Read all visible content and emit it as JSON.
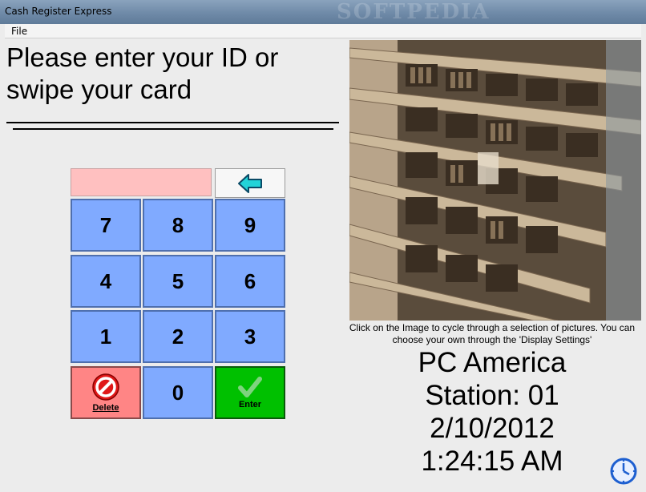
{
  "window": {
    "title": "Cash Register Express",
    "watermark": "SOFTPEDIA"
  },
  "menu": {
    "file": "File"
  },
  "login": {
    "prompt": "Please enter your ID or swipe your card",
    "input_value": ""
  },
  "keypad": {
    "keys": [
      "7",
      "8",
      "9",
      "4",
      "5",
      "6",
      "1",
      "2",
      "3"
    ],
    "zero": "0",
    "delete_label": "Delete",
    "enter_label": "Enter"
  },
  "display": {
    "caption": "Click on the Image to cycle through a selection of pictures. You can choose your own through the 'Display Settings'",
    "company": "PC America",
    "station": "Station: 01",
    "date": "2/10/2012",
    "time": "1:24:15 AM"
  },
  "colors": {
    "key_blue": "#80aaff",
    "delete_red": "#ff8585",
    "enter_green": "#00c000",
    "input_pink": "#ffc0c0",
    "arrow_cyan": "#22d3d8"
  },
  "icons": [
    "back-arrow-icon",
    "no-entry-icon",
    "checkmark-icon",
    "clock-icon"
  ]
}
